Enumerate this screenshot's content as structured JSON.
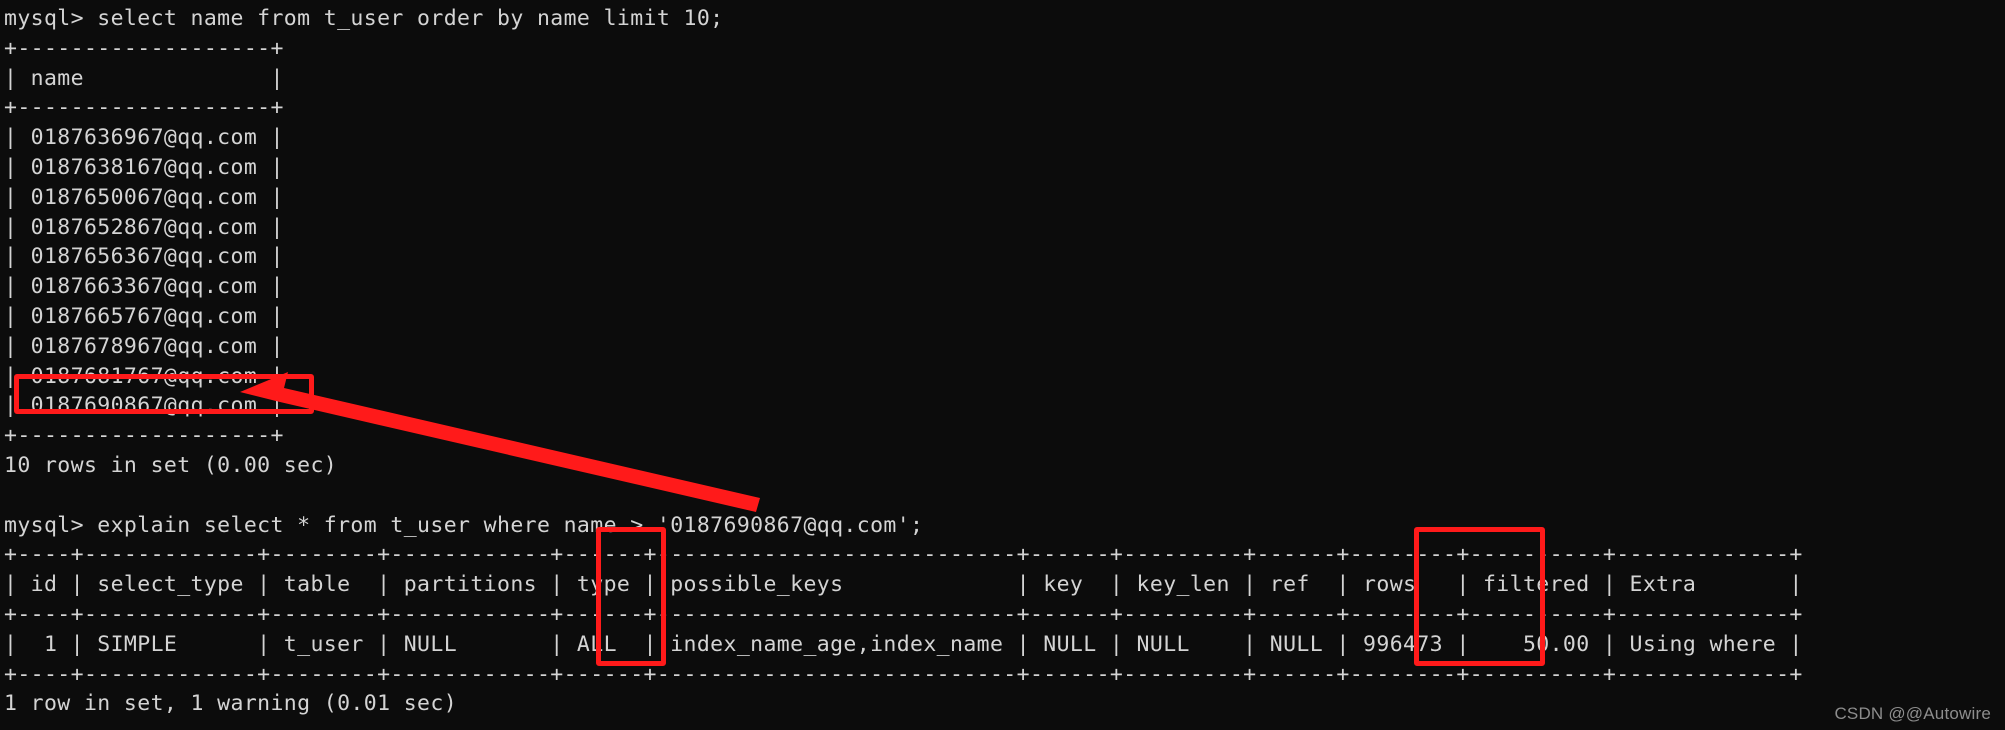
{
  "terminal": {
    "prompt_1": "mysql> select name from t_user order by name limit 10;",
    "result1": {
      "rule_top": "+-------------------+",
      "header": "| name              |",
      "rule_mid": "+-------------------+",
      "rows": [
        "| 0187636967@qq.com |",
        "| 0187638167@qq.com |",
        "| 0187650067@qq.com |",
        "| 0187652867@qq.com |",
        "| 0187656367@qq.com |",
        "| 0187663367@qq.com |",
        "| 0187665767@qq.com |",
        "| 0187678967@qq.com |",
        "| 0187681767@qq.com |",
        "| 0187690867@qq.com |"
      ],
      "rule_bottom": "+-------------------+",
      "status": "10 rows in set (0.00 sec)"
    },
    "prompt_2": "mysql> explain select * from t_user where name > '0187690867@qq.com';",
    "result2": {
      "rule_top": "+----+-------------+--------+------------+------+---------------------------+------+---------+------+--------+----------+-------------+",
      "header": "| id | select_type | table  | partitions | type | possible_keys             | key  | key_len | ref  | rows   | filtered | Extra       |",
      "rule_mid": "+----+-------------+--------+------------+------+---------------------------+------+---------+------+--------+----------+-------------+",
      "row": "|  1 | SIMPLE      | t_user | NULL       | ALL  | index_name_age,index_name | NULL | NULL    | NULL | 996473 |    50.00 | Using where |",
      "rule_bottom": "+----+-------------+--------+------------+------+---------------------------+------+---------+------+--------+----------+-------------+",
      "status": "1 row in set, 1 warning (0.01 sec)"
    }
  },
  "explain_table": {
    "columns": [
      "id",
      "select_type",
      "table",
      "partitions",
      "type",
      "possible_keys",
      "key",
      "key_len",
      "ref",
      "rows",
      "filtered",
      "Extra"
    ],
    "row": [
      "1",
      "SIMPLE",
      "t_user",
      "NULL",
      "ALL",
      "index_name_age,index_name",
      "NULL",
      "NULL",
      "NULL",
      "996473",
      "50.00",
      "Using where"
    ]
  },
  "annotations": {
    "highlight_color": "#ff1a1a",
    "highlighted_email": "0187690867@qq.com",
    "highlighted_columns": [
      "type",
      "rows"
    ],
    "arrow_label": "arrow-pointing-to-highlighted-email"
  },
  "watermark": "CSDN @@Autowire"
}
